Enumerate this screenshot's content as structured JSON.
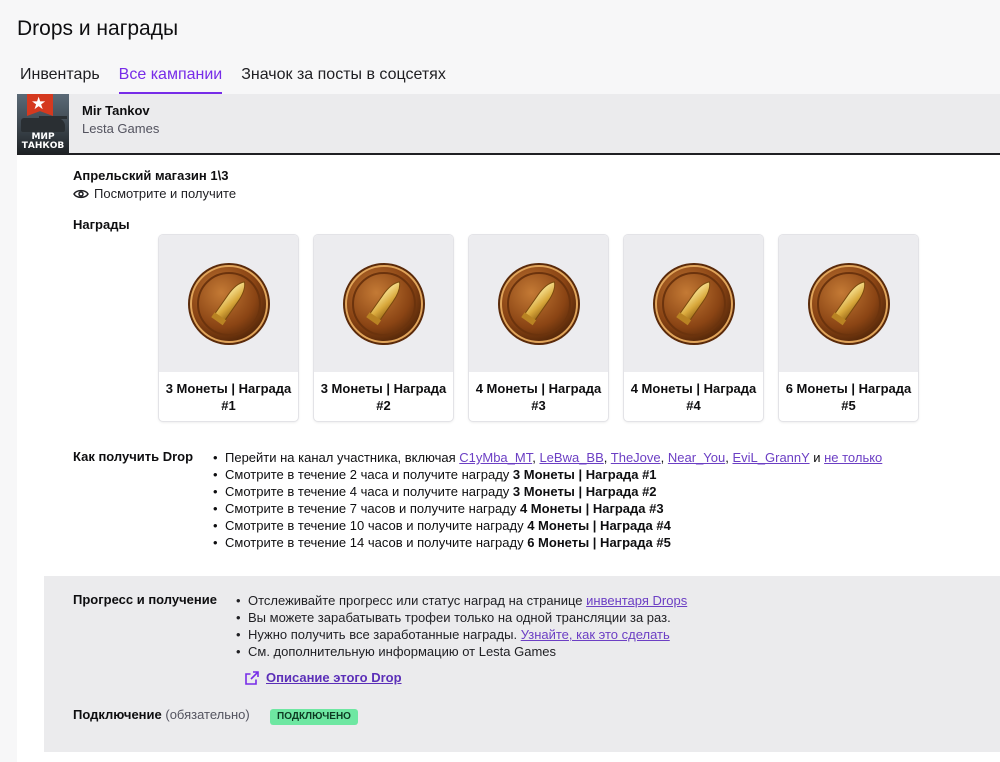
{
  "page": {
    "title": "Drops и награды"
  },
  "tabs": [
    {
      "label": "Инвентарь",
      "active": false
    },
    {
      "label": "Все кампании",
      "active": true
    },
    {
      "label": "Значок за посты в соцсетях",
      "active": false
    }
  ],
  "campaign": {
    "game_name": "Mir Tankov",
    "publisher": "Lesta Games",
    "thumb_text_line1": "МИР",
    "thumb_text_line2": "ТАНКОВ",
    "name": "Апрельский магазин 1\\3",
    "watch_text": "Посмотрите и получите"
  },
  "rewards_title": "Награды",
  "rewards": [
    {
      "label": "3 Монеты | Награда #1"
    },
    {
      "label": "3 Монеты | Награда #2"
    },
    {
      "label": "4 Монеты | Награда #3"
    },
    {
      "label": "4 Монеты | Награда #4"
    },
    {
      "label": "6 Монеты | Награда #5"
    }
  ],
  "how_to": {
    "title": "Как получить Drop",
    "channel_prefix": "Перейти на канал участника, включая",
    "channels": [
      "C1yMba_MT",
      "LeBwa_BB",
      "TheJove",
      "Near_You",
      "EviL_GrannY"
    ],
    "and_text": "и",
    "more_link": "не только",
    "steps": [
      {
        "text": "Смотрите в течение 2 часа и получите награду",
        "reward": "3 Монеты | Награда #1"
      },
      {
        "text": "Смотрите в течение 4 часа и получите награду",
        "reward": "3 Монеты | Награда #2"
      },
      {
        "text": "Смотрите в течение 7 часов и получите награду",
        "reward": "4 Монеты | Награда #3"
      },
      {
        "text": "Смотрите в течение 10 часов и получите награду",
        "reward": "4 Монеты | Награда #4"
      },
      {
        "text": "Смотрите в течение 14 часов и получите награду",
        "reward": "6 Монеты | Награда #5"
      }
    ]
  },
  "progress": {
    "title": "Прогресс и получение",
    "item1_text": "Отслеживайте прогресс или статус наград на странице",
    "item1_link": "инвентаря Drops",
    "item2_text": "Вы можете зарабатывать трофеи только на одной трансляции за раз.",
    "item3_text": "Нужно получить все заработанные награды.",
    "item3_link": "Узнайте, как это сделать",
    "item4_text": "См. дополнительную информацию от Lesta Games",
    "description_link": "Описание этого Drop"
  },
  "connection": {
    "label": "Подключение",
    "required": "(обязательно)",
    "status": "ПОДКЛЮЧЕНО"
  },
  "colors": {
    "accent": "#772ce8",
    "link": "#6c3fc4",
    "badge": "#6ee7a2"
  }
}
